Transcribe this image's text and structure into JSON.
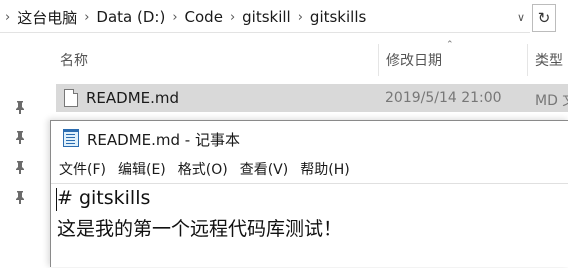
{
  "explorer": {
    "breadcrumb": [
      {
        "label": "这台电脑"
      },
      {
        "label": "Data (D:)"
      },
      {
        "label": "Code"
      },
      {
        "label": "gitskill"
      },
      {
        "label": "gitskills"
      }
    ],
    "breadcrumb_separator_icon": "chevron-right-icon",
    "dropdown_icon": "chevron-down-icon",
    "refresh_icon": "refresh-icon",
    "columns": {
      "name": "名称",
      "date_modified": "修改日期",
      "type": "类型"
    },
    "files": [
      {
        "name": "README.md",
        "date_modified": "2019/5/14 21:00",
        "type": "MD 文"
      }
    ],
    "pin_icon": "pin-icon",
    "selected_row_color": "#d9d9d9"
  },
  "notepad": {
    "title": "README.md - 记事本",
    "menu": [
      "文件(F)",
      "编辑(E)",
      "格式(O)",
      "查看(V)",
      "帮助(H)"
    ],
    "content_lines": [
      "# gitskills",
      "这是我的第一个远程代码库测试！"
    ]
  }
}
